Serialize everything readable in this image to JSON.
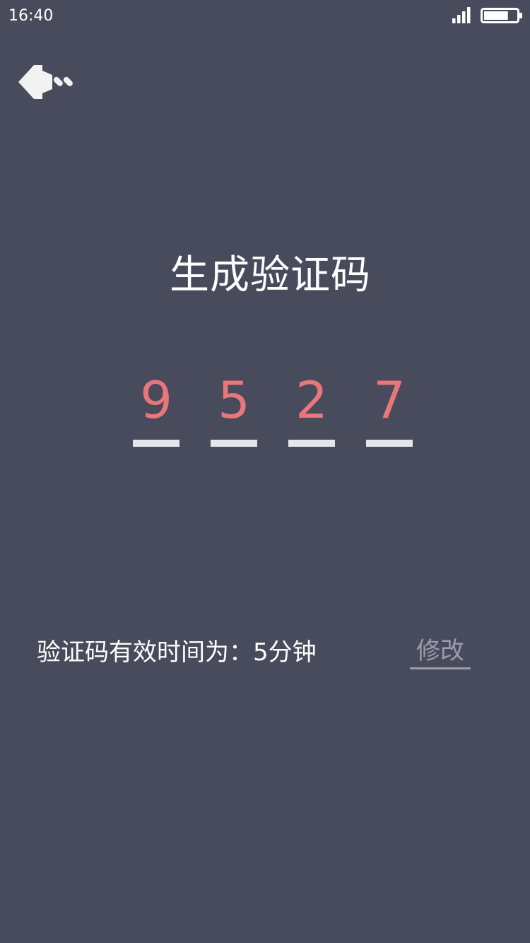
{
  "status_bar": {
    "time": "16:40",
    "signal_icon": "signal-bars-icon",
    "battery_icon": "battery-icon",
    "battery_level": 0.75
  },
  "nav": {
    "back_icon": "back-arrow-icon"
  },
  "page": {
    "title": "生成验证码"
  },
  "code": {
    "digits": [
      "9",
      "5",
      "2",
      "7"
    ]
  },
  "validity": {
    "text": "验证码有效时间为：5分钟",
    "modify_label": "修改"
  },
  "colors": {
    "background": "#474b5c",
    "digit": "#e8767a",
    "underline": "#e6e6ea",
    "modify": "#9a9caa"
  }
}
